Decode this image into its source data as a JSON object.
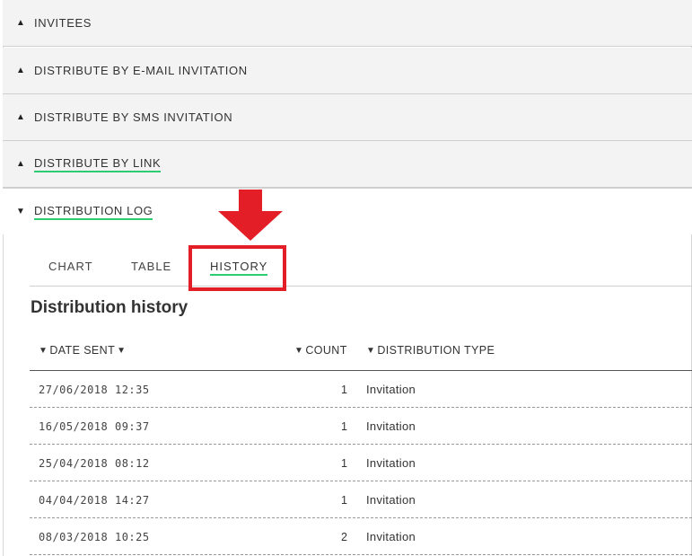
{
  "sections": [
    {
      "title": "INVITEES",
      "expanded": false,
      "arrow": "▲"
    },
    {
      "title": "DISTRIBUTE BY E-MAIL INVITATION",
      "expanded": false,
      "arrow": "▲"
    },
    {
      "title": "DISTRIBUTE BY SMS INVITATION",
      "expanded": false,
      "arrow": "▲"
    },
    {
      "title": "DISTRIBUTE BY LINK",
      "expanded": false,
      "arrow": "▲"
    },
    {
      "title": "DISTRIBUTION LOG",
      "expanded": true,
      "arrow": "▼"
    }
  ],
  "tabs": [
    {
      "label": "CHART",
      "active": false
    },
    {
      "label": "TABLE",
      "active": false
    },
    {
      "label": "HISTORY",
      "active": true
    }
  ],
  "history": {
    "heading": "Distribution history",
    "columns": {
      "date_sent": "DATE SENT",
      "count": "COUNT",
      "distribution_type": "DISTRIBUTION TYPE"
    },
    "rows": [
      {
        "date": "27/06/2018 12:35",
        "count": "1",
        "type": "Invitation"
      },
      {
        "date": "16/05/2018 09:37",
        "count": "1",
        "type": "Invitation"
      },
      {
        "date": "25/04/2018 08:12",
        "count": "1",
        "type": "Invitation"
      },
      {
        "date": "04/04/2018 14:27",
        "count": "1",
        "type": "Invitation"
      },
      {
        "date": "08/03/2018 10:25",
        "count": "2",
        "type": "Invitation"
      }
    ]
  },
  "icons": {
    "filter": "filter-icon",
    "sort_desc": "sort-descending-icon",
    "annotation_arrow": "down-arrow-icon"
  },
  "colors": {
    "accent_underline": "#2ecc71",
    "annotation_red": "#e41e26",
    "section_bg": "#f3f3f3"
  }
}
